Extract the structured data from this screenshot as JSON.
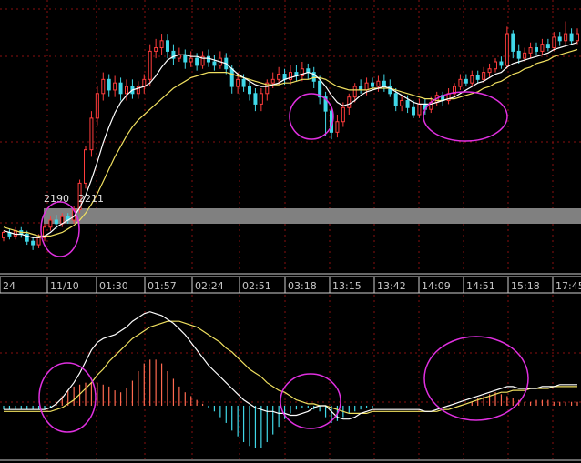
{
  "colors": {
    "background": "#000000",
    "grid": "#8a1010",
    "up_candle": "#ff3c3c",
    "down_candle": "#40d8e8",
    "ma_fast": "#ffffff",
    "ma_slow": "#f0e060",
    "hist_up": "#ff6a50",
    "hist_down": "#40d8e8",
    "highlight_band": "#808080",
    "circle": "#e030e0",
    "axis_text": "#c8c8c8"
  },
  "chart_data": [
    {
      "type": "candlestick",
      "panel": "price",
      "annotations": [
        "2190",
        "2211"
      ],
      "candles": [
        [
          2180,
          2183,
          2178,
          2184
        ],
        [
          2183,
          2181,
          2179,
          2185
        ],
        [
          2181,
          2184,
          2179,
          2186
        ],
        [
          2184,
          2182,
          2180,
          2186
        ],
        [
          2182,
          2178,
          2176,
          2184
        ],
        [
          2178,
          2176,
          2173,
          2180
        ],
        [
          2176,
          2180,
          2174,
          2182
        ],
        [
          2180,
          2186,
          2178,
          2188
        ],
        [
          2186,
          2190,
          2184,
          2192
        ],
        [
          2190,
          2188,
          2185,
          2193
        ],
        [
          2188,
          2192,
          2186,
          2194
        ],
        [
          2192,
          2190,
          2188,
          2194
        ],
        [
          2190,
          2196,
          2188,
          2198
        ],
        [
          2196,
          2211,
          2194,
          2213
        ],
        [
          2211,
          2230,
          2208,
          2232
        ],
        [
          2230,
          2248,
          2226,
          2252
        ],
        [
          2248,
          2262,
          2244,
          2266
        ],
        [
          2262,
          2270,
          2258,
          2274
        ],
        [
          2270,
          2264,
          2260,
          2273
        ],
        [
          2264,
          2268,
          2260,
          2272
        ],
        [
          2268,
          2262,
          2258,
          2271
        ],
        [
          2262,
          2266,
          2258,
          2270
        ],
        [
          2266,
          2262,
          2259,
          2270
        ],
        [
          2262,
          2266,
          2259,
          2269
        ],
        [
          2266,
          2270,
          2262,
          2273
        ],
        [
          2270,
          2286,
          2266,
          2290
        ],
        [
          2286,
          2288,
          2282,
          2293
        ],
        [
          2288,
          2292,
          2284,
          2296
        ],
        [
          2292,
          2286,
          2282,
          2296
        ],
        [
          2286,
          2282,
          2278,
          2290
        ],
        [
          2282,
          2284,
          2280,
          2288
        ],
        [
          2284,
          2280,
          2276,
          2287
        ],
        [
          2280,
          2282,
          2277,
          2286
        ],
        [
          2282,
          2278,
          2275,
          2285
        ],
        [
          2278,
          2283,
          2276,
          2286
        ],
        [
          2283,
          2280,
          2277,
          2287
        ],
        [
          2280,
          2278,
          2275,
          2284
        ],
        [
          2278,
          2282,
          2276,
          2286
        ],
        [
          2282,
          2276,
          2273,
          2285
        ],
        [
          2276,
          2266,
          2262,
          2278
        ],
        [
          2266,
          2270,
          2262,
          2274
        ],
        [
          2270,
          2266,
          2263,
          2273
        ],
        [
          2266,
          2262,
          2258,
          2269
        ],
        [
          2262,
          2256,
          2252,
          2265
        ],
        [
          2256,
          2262,
          2252,
          2265
        ],
        [
          2262,
          2268,
          2258,
          2270
        ],
        [
          2268,
          2270,
          2265,
          2274
        ],
        [
          2270,
          2273,
          2267,
          2277
        ],
        [
          2273,
          2270,
          2267,
          2276
        ],
        [
          2270,
          2274,
          2267,
          2278
        ],
        [
          2274,
          2272,
          2269,
          2278
        ],
        [
          2272,
          2276,
          2269,
          2280
        ],
        [
          2276,
          2274,
          2270,
          2279
        ],
        [
          2274,
          2269,
          2265,
          2277
        ],
        [
          2269,
          2260,
          2256,
          2272
        ],
        [
          2260,
          2252,
          2238,
          2263
        ],
        [
          2252,
          2240,
          2236,
          2255
        ],
        [
          2240,
          2246,
          2237,
          2250
        ],
        [
          2246,
          2254,
          2243,
          2257
        ],
        [
          2254,
          2260,
          2250,
          2262
        ],
        [
          2260,
          2266,
          2257,
          2268
        ],
        [
          2266,
          2264,
          2262,
          2270
        ],
        [
          2264,
          2268,
          2261,
          2271
        ],
        [
          2268,
          2266,
          2264,
          2271
        ],
        [
          2266,
          2269,
          2263,
          2272
        ],
        [
          2269,
          2266,
          2263,
          2273
        ],
        [
          2266,
          2262,
          2260,
          2270
        ],
        [
          2262,
          2255,
          2252,
          2265
        ],
        [
          2255,
          2258,
          2252,
          2261
        ],
        [
          2258,
          2254,
          2251,
          2261
        ],
        [
          2254,
          2250,
          2248,
          2258
        ],
        [
          2250,
          2256,
          2248,
          2259
        ],
        [
          2256,
          2253,
          2250,
          2259
        ],
        [
          2253,
          2257,
          2251,
          2260
        ],
        [
          2257,
          2261,
          2255,
          2263
        ],
        [
          2261,
          2258,
          2255,
          2263
        ],
        [
          2258,
          2262,
          2256,
          2265
        ],
        [
          2262,
          2266,
          2260,
          2268
        ],
        [
          2266,
          2270,
          2264,
          2273
        ],
        [
          2270,
          2268,
          2266,
          2273
        ],
        [
          2268,
          2272,
          2266,
          2275
        ],
        [
          2272,
          2270,
          2268,
          2275
        ],
        [
          2270,
          2274,
          2268,
          2277
        ],
        [
          2274,
          2276,
          2271,
          2279
        ],
        [
          2276,
          2280,
          2274,
          2282
        ],
        [
          2280,
          2278,
          2276,
          2283
        ],
        [
          2278,
          2296,
          2276,
          2300
        ],
        [
          2296,
          2286,
          2282,
          2298
        ],
        [
          2286,
          2282,
          2279,
          2290
        ],
        [
          2282,
          2285,
          2280,
          2288
        ],
        [
          2285,
          2288,
          2282,
          2291
        ],
        [
          2288,
          2286,
          2284,
          2291
        ],
        [
          2286,
          2290,
          2284,
          2293
        ],
        [
          2290,
          2288,
          2286,
          2293
        ],
        [
          2288,
          2294,
          2286,
          2297
        ],
        [
          2294,
          2292,
          2289,
          2297
        ],
        [
          2292,
          2296,
          2290,
          2303
        ],
        [
          2296,
          2292,
          2290,
          2299
        ],
        [
          2292,
          2296,
          2290,
          2299
        ]
      ],
      "ma_fast": [
        2184,
        2183,
        2182,
        2182,
        2181,
        2180,
        2180,
        2181,
        2183,
        2186,
        2188,
        2190,
        2192,
        2197,
        2204,
        2213,
        2223,
        2234,
        2243,
        2251,
        2257,
        2261,
        2264,
        2265,
        2266,
        2268,
        2272,
        2277,
        2281,
        2283,
        2284,
        2284,
        2283,
        2283,
        2282,
        2282,
        2281,
        2280,
        2279,
        2276,
        2273,
        2271,
        2269,
        2267,
        2266,
        2266,
        2267,
        2268,
        2270,
        2271,
        2272,
        2273,
        2274,
        2273,
        2270,
        2266,
        2261,
        2257,
        2255,
        2256,
        2258,
        2261,
        2263,
        2264,
        2265,
        2266,
        2265,
        2263,
        2261,
        2259,
        2257,
        2256,
        2256,
        2256,
        2257,
        2258,
        2259,
        2260,
        2262,
        2264,
        2266,
        2268,
        2269,
        2271,
        2273,
        2274,
        2277,
        2279,
        2280,
        2281,
        2282,
        2283,
        2284,
        2285,
        2287,
        2288,
        2289,
        2290,
        2291
      ],
      "ma_slow": [
        2186,
        2185,
        2184,
        2183,
        2183,
        2182,
        2181,
        2181,
        2181,
        2182,
        2183,
        2185,
        2187,
        2190,
        2194,
        2199,
        2205,
        2212,
        2219,
        2226,
        2232,
        2238,
        2243,
        2247,
        2250,
        2253,
        2256,
        2259,
        2262,
        2265,
        2267,
        2269,
        2271,
        2272,
        2273,
        2274,
        2274,
        2274,
        2274,
        2273,
        2272,
        2271,
        2270,
        2269,
        2268,
        2267,
        2267,
        2267,
        2268,
        2268,
        2269,
        2270,
        2270,
        2271,
        2271,
        2270,
        2268,
        2266,
        2265,
        2264,
        2264,
        2264,
        2264,
        2265,
        2265,
        2265,
        2265,
        2264,
        2263,
        2262,
        2261,
        2260,
        2259,
        2259,
        2258,
        2258,
        2259,
        2259,
        2260,
        2261,
        2262,
        2263,
        2265,
        2266,
        2268,
        2269,
        2271,
        2273,
        2274,
        2276,
        2277,
        2279,
        2280,
        2281,
        2283,
        2284,
        2285,
        2286,
        2287
      ],
      "ylim": [
        2160,
        2310
      ]
    },
    {
      "type": "bar",
      "panel": "macd",
      "histogram": [
        -2,
        -2,
        -2,
        -2,
        -2,
        -2,
        -2,
        -2,
        -1,
        2,
        5,
        8,
        10,
        11,
        12,
        12,
        12,
        11,
        10,
        8,
        7,
        9,
        13,
        18,
        22,
        24,
        24,
        22,
        18,
        14,
        10,
        7,
        5,
        3,
        1,
        -1,
        -3,
        -6,
        -9,
        -13,
        -16,
        -19,
        -21,
        -22,
        -22,
        -19,
        -15,
        -11,
        -7,
        -4,
        -2,
        -1,
        -1,
        -2,
        -3,
        -6,
        -9,
        -8,
        -6,
        -4,
        -3,
        -2,
        -1,
        -1,
        0,
        0,
        0,
        0,
        0,
        0,
        0,
        0,
        0,
        0,
        0,
        0,
        0,
        0,
        0,
        0,
        2,
        4,
        5,
        6,
        7,
        6,
        5,
        4,
        3,
        2,
        2,
        3,
        3,
        3,
        2,
        2,
        2,
        2,
        2
      ],
      "dif": [
        -2,
        -2,
        -2,
        -2,
        -2,
        -2,
        -2,
        -2,
        -1,
        1,
        4,
        8,
        12,
        17,
        23,
        29,
        33,
        35,
        36,
        37,
        39,
        41,
        44,
        46,
        48,
        49,
        48,
        47,
        45,
        43,
        40,
        37,
        33,
        29,
        25,
        21,
        18,
        15,
        12,
        9,
        6,
        3,
        1,
        -1,
        -2,
        -3,
        -3,
        -4,
        -4,
        -5,
        -5,
        -4,
        -3,
        -1,
        0,
        0,
        -3,
        -6,
        -7,
        -7,
        -6,
        -4,
        -3,
        -2,
        -2,
        -2,
        -2,
        -2,
        -2,
        -2,
        -2,
        -2,
        -3,
        -3,
        -2,
        -1,
        0,
        1,
        2,
        3,
        4,
        5,
        6,
        7,
        8,
        9,
        10,
        10,
        9,
        9,
        9,
        9,
        10,
        10,
        10,
        11,
        11,
        11,
        11
      ],
      "dea": [
        -3,
        -3,
        -3,
        -3,
        -3,
        -3,
        -3,
        -3,
        -3,
        -2,
        -1,
        1,
        3,
        6,
        9,
        12,
        16,
        19,
        23,
        26,
        29,
        32,
        35,
        37,
        39,
        41,
        42,
        43,
        44,
        44,
        44,
        43,
        42,
        41,
        39,
        37,
        35,
        33,
        30,
        28,
        25,
        22,
        19,
        17,
        15,
        12,
        10,
        8,
        7,
        5,
        3,
        2,
        1,
        1,
        0,
        0,
        -1,
        -2,
        -3,
        -4,
        -4,
        -4,
        -4,
        -3,
        -3,
        -3,
        -3,
        -3,
        -3,
        -3,
        -3,
        -3,
        -3,
        -3,
        -3,
        -2,
        -2,
        -1,
        0,
        1,
        2,
        3,
        4,
        5,
        6,
        7,
        7,
        8,
        8,
        8,
        9,
        9,
        9,
        9,
        10,
        10,
        10,
        10,
        10
      ],
      "ylim": [
        -28,
        55
      ]
    }
  ],
  "time_axis": {
    "labels": [
      "24",
      "11/10",
      "01:30",
      "01:57",
      "02:24",
      "02:51",
      "03:18",
      "13:15",
      "13:42",
      "14:09",
      "14:51",
      "15:18",
      "17:45"
    ]
  }
}
